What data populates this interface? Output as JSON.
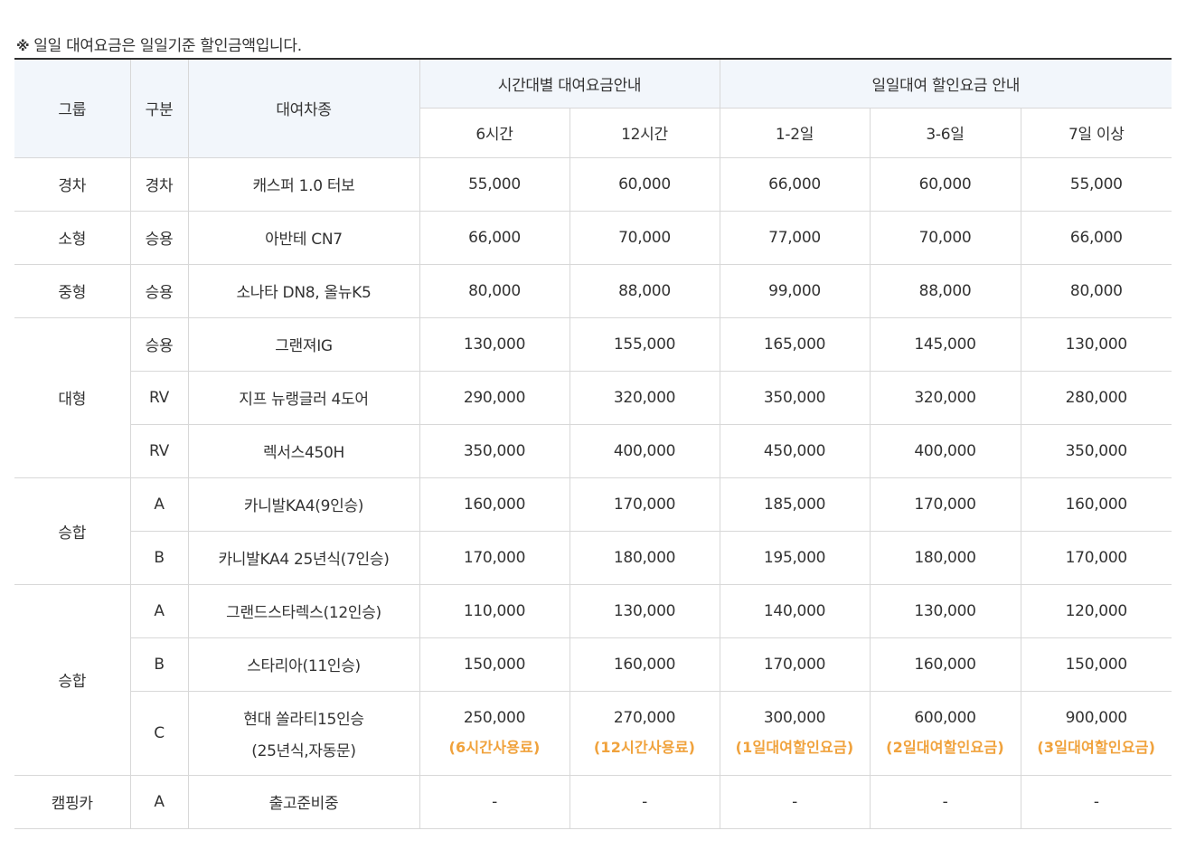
{
  "note": {
    "mark": "※",
    "text": "일일 대여요금은 일일기준 할인금액입니다."
  },
  "colors": {
    "highlight": "#f0a23c",
    "header_bg": "#f2f6fb",
    "border": "#d8d8d8",
    "top_rule": "#2f2f2f"
  },
  "header": {
    "group": "그룹",
    "category": "구분",
    "model": "대여차종",
    "hourly_title": "시간대별 대여요금안내",
    "daily_title": "일일대여 할인요금 안내",
    "h6": "6시간",
    "h12": "12시간",
    "d12": "1-2일",
    "d36": "3-6일",
    "d7": "7일 이상"
  },
  "rows": [
    {
      "group": "경차",
      "category": "경차",
      "model": "캐스퍼 1.0 터보",
      "h6": "55,000",
      "h12": "60,000",
      "d12": "66,000",
      "d36": "60,000",
      "d7": "55,000"
    },
    {
      "group": "소형",
      "category": "승용",
      "model": "아반테 CN7",
      "h6": "66,000",
      "h12": "70,000",
      "d12": "77,000",
      "d36": "70,000",
      "d7": "66,000"
    },
    {
      "group": "중형",
      "category": "승용",
      "model": "소나타 DN8, 올뉴K5",
      "h6": "80,000",
      "h12": "88,000",
      "d12": "99,000",
      "d36": "88,000",
      "d7": "80,000"
    },
    {
      "group": "대형",
      "category": "승용",
      "model": "그랜져IG",
      "h6": "130,000",
      "h12": "155,000",
      "d12": "165,000",
      "d36": "145,000",
      "d7": "130,000"
    },
    {
      "category": "RV",
      "model": "지프 뉴랭글러 4도어",
      "h6": "290,000",
      "h12": "320,000",
      "d12": "350,000",
      "d36": "320,000",
      "d7": "280,000"
    },
    {
      "category": "RV",
      "model": "렉서스450H",
      "h6": "350,000",
      "h12": "400,000",
      "d12": "450,000",
      "d36": "400,000",
      "d7": "350,000"
    },
    {
      "group": "승합",
      "category": "A",
      "model": "카니발KA4(9인승)",
      "h6": "160,000",
      "h12": "170,000",
      "d12": "185,000",
      "d36": "170,000",
      "d7": "160,000"
    },
    {
      "category": "B",
      "model": "카니발KA4 25년식(7인승)",
      "h6": "170,000",
      "h12": "180,000",
      "d12": "195,000",
      "d36": "180,000",
      "d7": "170,000"
    },
    {
      "group": "승합",
      "category": "A",
      "model": "그랜드스타렉스(12인승)",
      "h6": "110,000",
      "h12": "130,000",
      "d12": "140,000",
      "d36": "130,000",
      "d7": "120,000"
    },
    {
      "category": "B",
      "model": "스타리아(11인승)",
      "h6": "150,000",
      "h12": "160,000",
      "d12": "170,000",
      "d36": "160,000",
      "d7": "150,000"
    },
    {
      "category": "C",
      "model": "현대 쏠라티15인승",
      "model_line2": "(25년식,자동문)",
      "h6": "250,000",
      "h6_note": "(6시간사용료)",
      "h12": "270,000",
      "h12_note": "(12시간사용료)",
      "d12": "300,000",
      "d12_note": "(1일대여할인요금)",
      "d36": "600,000",
      "d36_note": "(2일대여할인요금)",
      "d7": "900,000",
      "d7_note": "(3일대여할인요금)"
    },
    {
      "group": "캠핑카",
      "category": "A",
      "model": "출고준비중",
      "h6": "-",
      "h12": "-",
      "d12": "-",
      "d36": "-",
      "d7": "-"
    }
  ]
}
